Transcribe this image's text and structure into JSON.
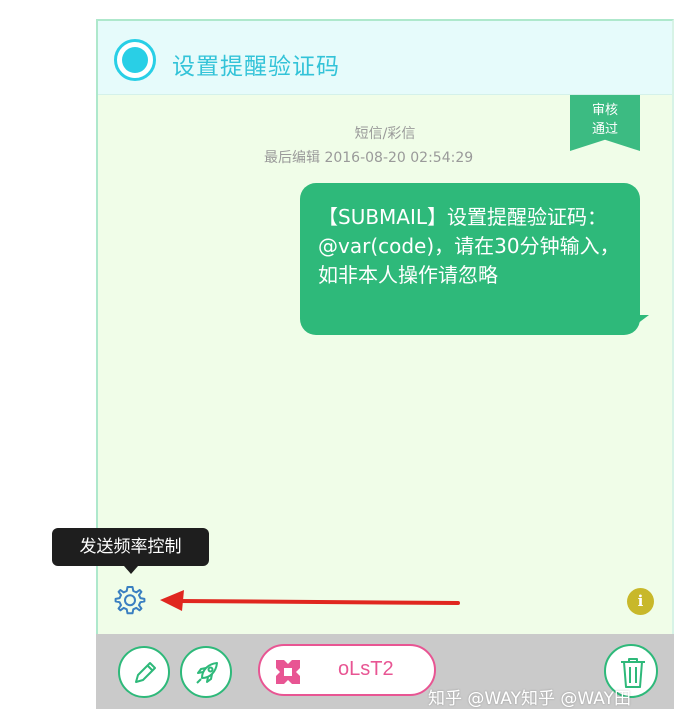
{
  "template": {
    "title": "设置提醒验证码",
    "status_ribbon": {
      "line1": "审核",
      "line2": "通过"
    },
    "message_type": "短信/彩信",
    "last_edited": "最后编辑 2016-08-20 02:54:29",
    "message_body": "【SUBMAIL】设置提醒验证码：@var(code)，请在30分钟输入，如非本人操作请忽略"
  },
  "tooltip": {
    "text": "发送频率控制"
  },
  "icons": {
    "settings": "gear-icon",
    "info": "info-icon",
    "edit": "pencil-icon",
    "send": "rocket-icon",
    "project": "project-icon",
    "delete": "trash-icon"
  },
  "info_glyph": "i",
  "toolbar": {
    "project_code": "oLsT2"
  },
  "watermark": "知乎 @WAY知乎 @WAY田",
  "colors": {
    "accent_cyan": "#29cfe6",
    "bubble_green": "#2eb97a",
    "ribbon_green": "#3cbb82",
    "pink": "#e85593",
    "arrow_red": "#e0271f",
    "info_yellow": "#c8b82a",
    "card_bg": "#f0fde8"
  }
}
